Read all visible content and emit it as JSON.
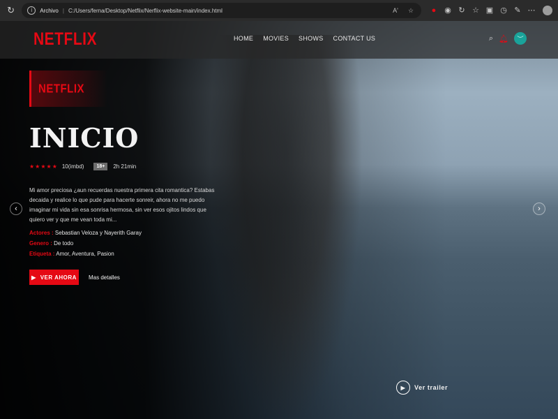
{
  "browser": {
    "scheme": "Archivo",
    "url": "C:/Users/ferna/Desktop/Netflix/Nerflix-website-main/index.html",
    "reload_icon": "↻",
    "info_icon": "i",
    "read_aloud": "A'"
  },
  "site": {
    "logo": "NETFLIX",
    "nav": [
      "HOME",
      "MOVIES",
      "SHOWS",
      "CONTACT US"
    ]
  },
  "hero": {
    "badge": "NETFLIX",
    "title": "INICIO",
    "stars": "★★★★★",
    "rating": "10(imbd)",
    "age": "18+",
    "duration": "2h 21min",
    "description": "Mi amor preciosa ¿aun recuerdas nuestra primera cita romantica? Estabas decaida y realice lo que pude para hacerte sonreir, ahora no me puedo imaginar mi vida sin esa sonrisa hermosa, sin ver esos ojitos lindos que quiero ver y que me vean toda mi...",
    "details": {
      "actors_label": "Actores :",
      "actors": "Sebastian Veloza y Nayerith Garay",
      "genre_label": "Genero :",
      "genre": "De todo",
      "tag_label": "Etiqueta :",
      "tags": "Amor, Aventura, Pasion"
    },
    "watch_label": "VER AHORA",
    "more_label": "Mas detalles",
    "trailer_label": "Ver trailer"
  },
  "colors": {
    "accent": "#e50914",
    "avatar": "#1aa39a"
  }
}
